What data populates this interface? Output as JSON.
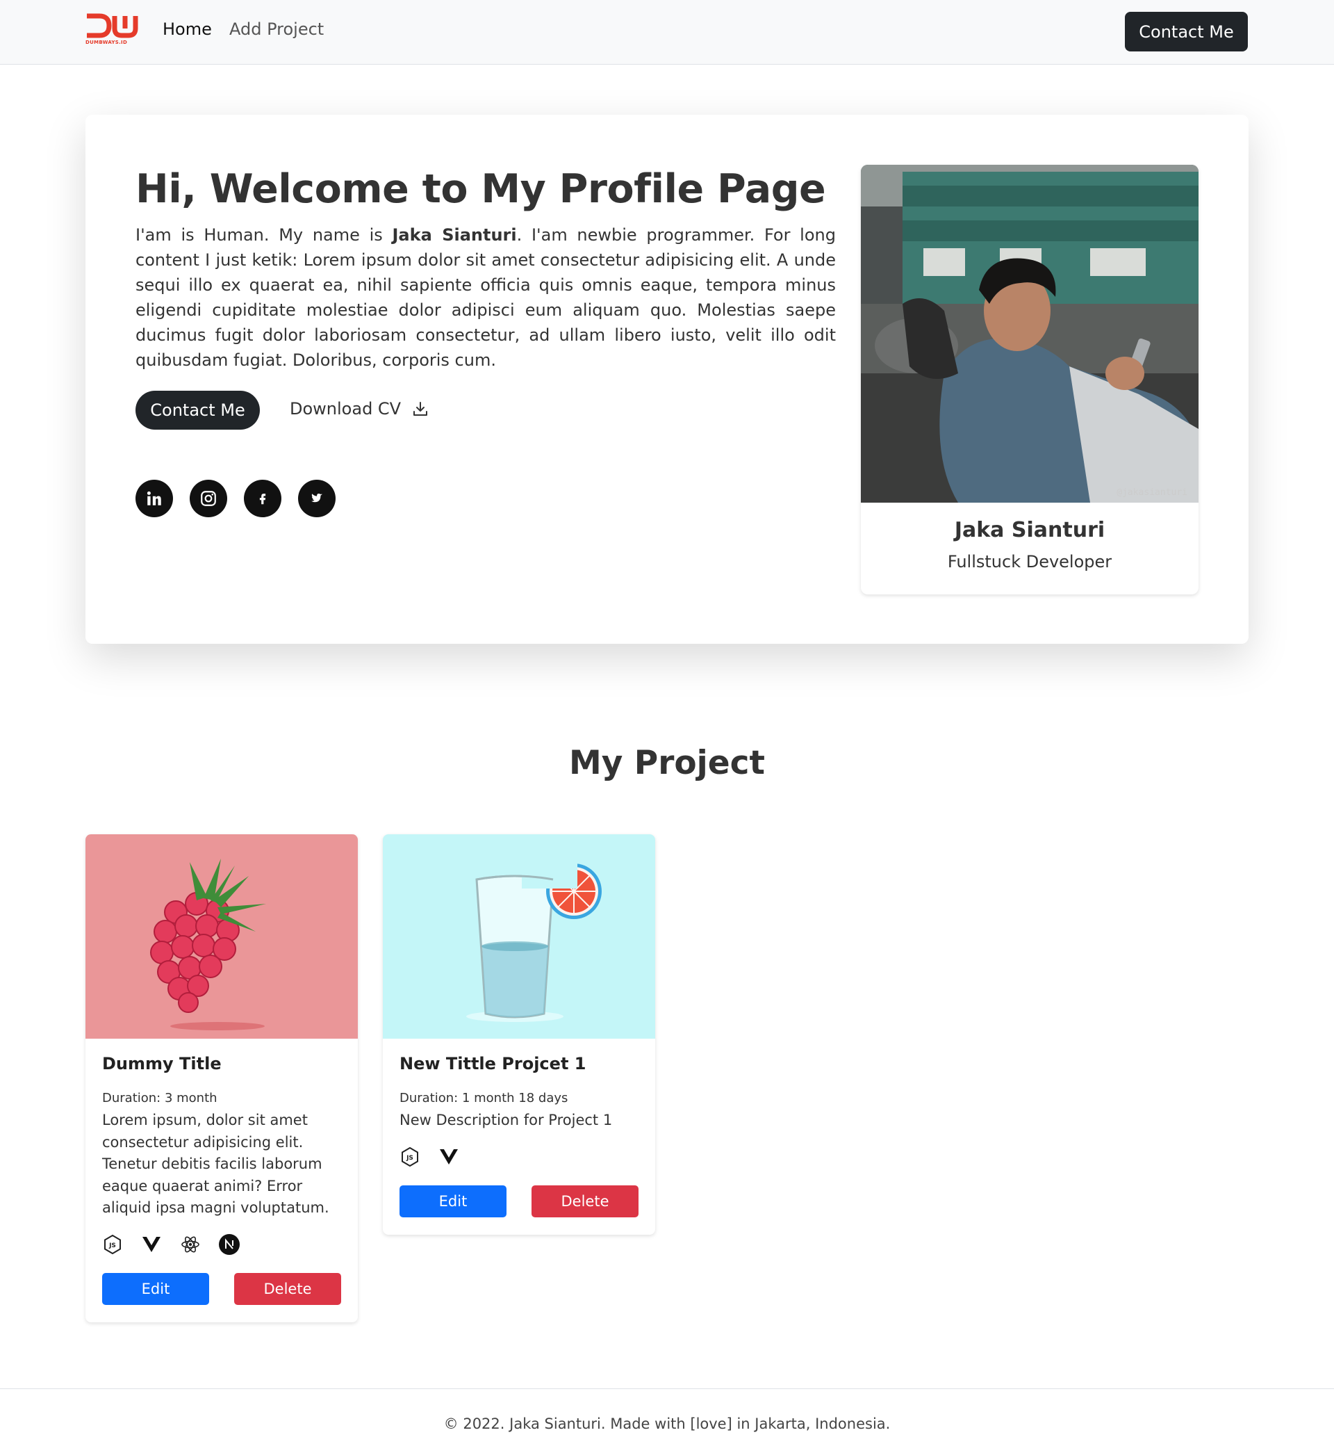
{
  "navbar": {
    "logo_text": "DUMBWAYS.ID",
    "home_label": "Home",
    "add_project_label": "Add Project",
    "contact_label": "Contact Me"
  },
  "hero": {
    "title": "Hi, Welcome to My Profile Page",
    "intro_before": "I'am is Human. My name is ",
    "intro_name": "Jaka Sianturi",
    "intro_after": ". I'am newbie programmer. For long content I just ketik: Lorem ipsum dolor sit amet consectetur adipisicing elit. A unde sequi illo ex quaerat ea, nihil sapiente officia quis omnis eaque, tempora minus eligendi cupiditate molestiae dolor adipisci eum aliquam quo. Molestias saepe ducimus fugit dolor laboriosam consectetur, ad ullam libero iusto, velit illo odit quibusdam fugiat. Doloribus, corporis cum.",
    "contact_label": "Contact Me",
    "download_label": "Download CV",
    "socials": [
      "linkedin-icon",
      "instagram-icon",
      "facebook-icon",
      "twitter-icon"
    ]
  },
  "profile": {
    "name": "Jaka Sianturi",
    "role": "Fullstuck Developer",
    "photo_watermark": "@jakasianturi"
  },
  "projects": {
    "section_title": "My Project",
    "items": [
      {
        "title": "Dummy Title",
        "duration": "Duration: 3 month",
        "description": "Lorem ipsum, dolor sit amet consectetur adipisicing elit. Tenetur debitis facilis laborum eaque quaerat animi? Error aliquid ipsa magni voluptatum.",
        "tech": [
          "nodejs-icon",
          "vuejs-icon",
          "react-icon",
          "nextjs-icon"
        ],
        "edit_label": "Edit",
        "delete_label": "Delete"
      },
      {
        "title": "New Tittle Projcet 1",
        "duration": "Duration: 1 month 18 days",
        "description": "New Description for Project 1",
        "tech": [
          "nodejs-icon",
          "vuejs-icon"
        ],
        "edit_label": "Edit",
        "delete_label": "Delete"
      }
    ]
  },
  "footer": {
    "text": "© 2022. Jaka Sianturi. Made with [love] in Jakarta, Indonesia."
  },
  "colors": {
    "primary": "#0d6efd",
    "danger": "#dc3545",
    "dark": "#212529",
    "brand": "#e53b2a",
    "raspberry_bg": "#ea9698",
    "glass_bg": "#c4f6f8"
  }
}
